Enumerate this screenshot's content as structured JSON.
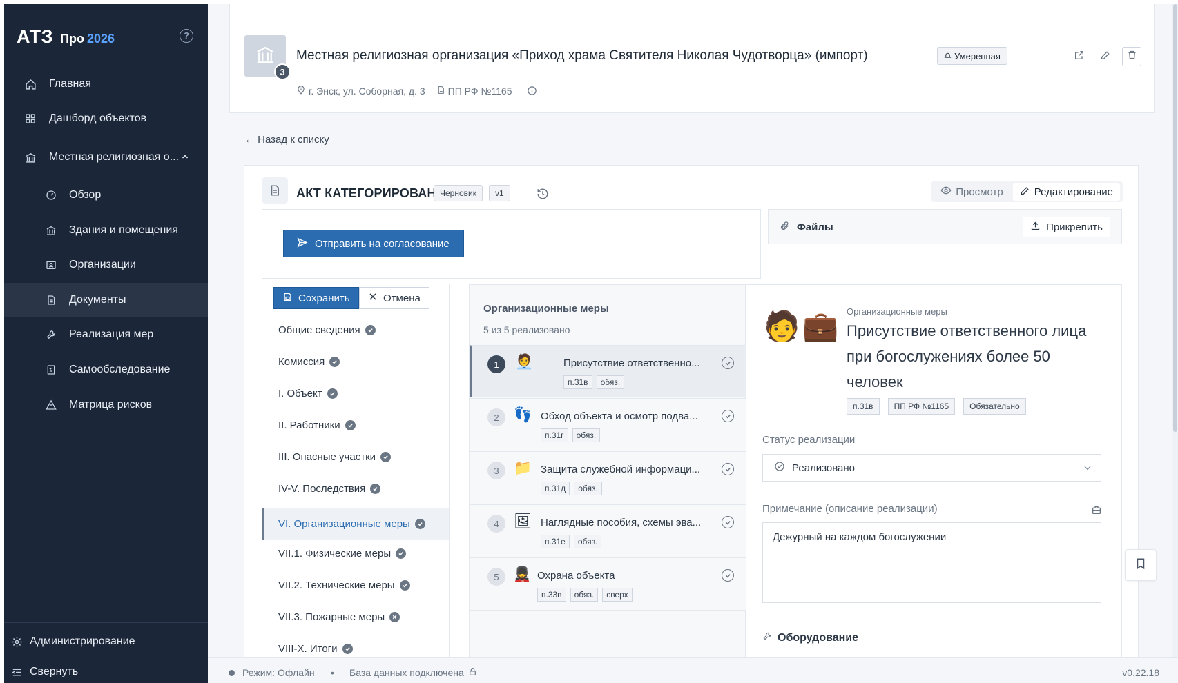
{
  "app": {
    "name": "АТЗ",
    "edition": "Про",
    "year": "2026"
  },
  "sidebar": {
    "items": [
      {
        "label": "Главная",
        "icon": "home-icon"
      },
      {
        "label": "Дашборд объектов",
        "icon": "grid-icon"
      },
      {
        "label": "Местная религиозная о...",
        "icon": "building-icon"
      }
    ],
    "subitems": [
      {
        "label": "Обзор",
        "icon": "gauge-icon"
      },
      {
        "label": "Здания и помещения",
        "icon": "building-icon"
      },
      {
        "label": "Организации",
        "icon": "id-card-icon"
      },
      {
        "label": "Документы",
        "icon": "document-icon"
      },
      {
        "label": "Реализация мер",
        "icon": "wrench-icon"
      },
      {
        "label": "Самообследование",
        "icon": "checklist-icon"
      },
      {
        "label": "Матрица рисков",
        "icon": "warning-icon"
      }
    ],
    "admin_label": "Администрирование",
    "collapse_label": "Свернуть"
  },
  "object": {
    "title": "Местная религиозная организация «Приход храма Святителя Николая Чудотворца» (импорт)",
    "badge_count": "3",
    "risk_level": "Умеренная",
    "address": "г. Энск, ул. Соборная, д. 3",
    "regulation": "ПП РФ №1165"
  },
  "nav": {
    "back_label": "← Назад к списку"
  },
  "document": {
    "title": "АКТ КАТЕГОРИРОВАНИЯ",
    "status": "Черновик",
    "version": "v1",
    "view_label": "Просмотр",
    "edit_label": "Редактирование",
    "submit_label": "Отправить на согласование",
    "files_label": "Файлы",
    "attach_label": "Прикрепить",
    "save_label": "Сохранить",
    "cancel_label": "Отмена"
  },
  "sections": [
    {
      "label": "Общие сведения",
      "state": "done"
    },
    {
      "label": "Комиссия",
      "state": "done"
    },
    {
      "label": "I. Объект",
      "state": "done"
    },
    {
      "label": "II. Работники",
      "state": "done"
    },
    {
      "label": "III. Опасные участки",
      "state": "done"
    },
    {
      "label": "IV-V. Последствия",
      "state": "done"
    },
    {
      "label": "VI. Организационные меры",
      "state": "done",
      "active": true
    },
    {
      "label": "VII.1. Физические меры",
      "state": "done"
    },
    {
      "label": "VII.2. Технические меры",
      "state": "done"
    },
    {
      "label": "VII.3. Пожарные меры",
      "state": "error"
    },
    {
      "label": "VIII-X. Итоги",
      "state": "done"
    }
  ],
  "measures": {
    "title": "Организационные меры",
    "progress": "5 из 5 реализовано",
    "items": [
      {
        "num": "1",
        "emoji": "🧑‍💼",
        "label": "Присутствие ответственно...",
        "tags": [
          "п.31в",
          "обяз."
        ]
      },
      {
        "num": "2",
        "emoji": "👣",
        "label": "Обход объекта и осмотр подва...",
        "tags": [
          "п.31г",
          "обяз."
        ]
      },
      {
        "num": "3",
        "emoji": "📁",
        "label": "Защита служебной информаци...",
        "tags": [
          "п.31д",
          "обяз."
        ]
      },
      {
        "num": "4",
        "emoji": "🖼",
        "label": "Наглядные пособия, схемы эва...",
        "tags": [
          "п.31е",
          "обяз."
        ]
      },
      {
        "num": "5",
        "emoji": "💂",
        "label": "Охрана объекта",
        "tags": [
          "п.33в",
          "обяз.",
          "сверх"
        ]
      }
    ]
  },
  "detail": {
    "emoji": "🧑💼",
    "category": "Организационные меры",
    "title": "Присутствие ответственного лица при богослужениях более 50 человек",
    "tags": [
      "п.31в",
      "ПП РФ №1165",
      "Обязательно"
    ],
    "status_label": "Статус реализации",
    "status_value": "Реализовано",
    "note_label": "Примечание (описание реализации)",
    "note_value": "Дежурный на каждом богослужении",
    "equipment_label": "Оборудование"
  },
  "status": {
    "mode": "Режим: Офлайн",
    "separator": "•",
    "db": "База данных подключена",
    "version": "v0.22.18"
  },
  "colors": {
    "sidebar_bg": "#1b2638",
    "accent": "#2b6cb0",
    "active_text": "#2b6cb0"
  }
}
